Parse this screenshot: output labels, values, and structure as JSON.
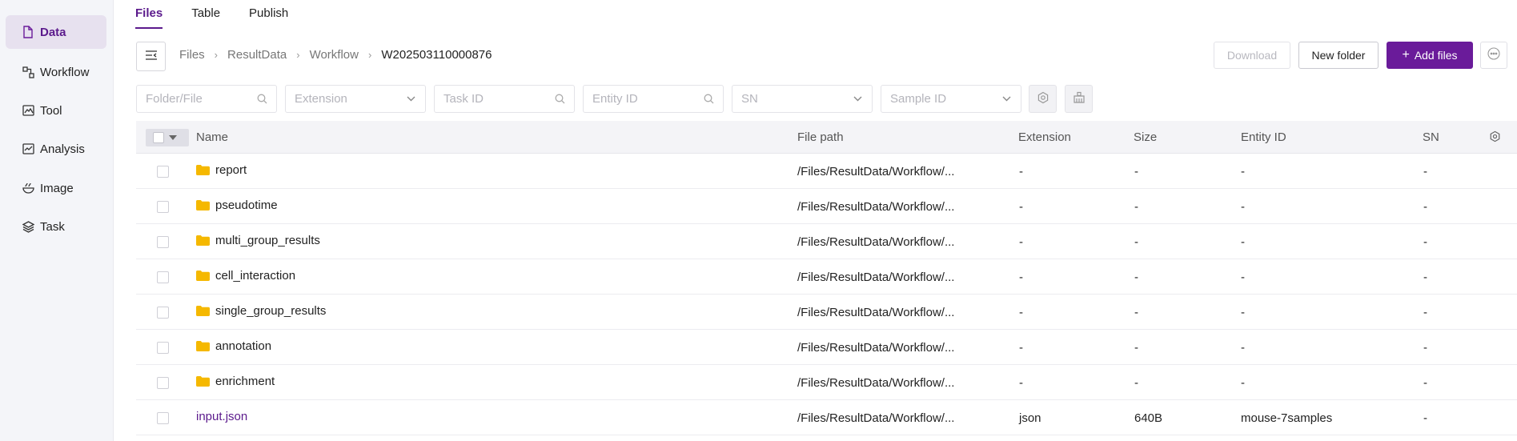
{
  "sidebar": {
    "items": [
      {
        "label": "Data",
        "icon": "file-icon",
        "active": true
      },
      {
        "label": "Workflow",
        "icon": "workflow-icon",
        "active": false
      },
      {
        "label": "Tool",
        "icon": "tool-icon",
        "active": false
      },
      {
        "label": "Analysis",
        "icon": "analysis-icon",
        "active": false
      },
      {
        "label": "Image",
        "icon": "image-icon",
        "active": false
      },
      {
        "label": "Task",
        "icon": "layers-icon",
        "active": false
      }
    ]
  },
  "tabs": [
    {
      "label": "Files",
      "active": true
    },
    {
      "label": "Table",
      "active": false
    },
    {
      "label": "Publish",
      "active": false
    }
  ],
  "breadcrumb": [
    "Files",
    "ResultData",
    "Workflow",
    "W202503110000876"
  ],
  "toolbar": {
    "download_label": "Download",
    "new_folder_label": "New folder",
    "add_files_label": "Add files"
  },
  "filters": {
    "folder_file_placeholder": "Folder/File",
    "extension_placeholder": "Extension",
    "task_id_placeholder": "Task ID",
    "entity_id_placeholder": "Entity ID",
    "sn_placeholder": "SN",
    "sample_id_placeholder": "Sample ID"
  },
  "table": {
    "columns": [
      "Name",
      "File path",
      "Extension",
      "Size",
      "Entity ID",
      "SN"
    ],
    "rows": [
      {
        "type": "folder",
        "name": "report",
        "path": "/Files/ResultData/Workflow/...",
        "extension": "-",
        "size": "-",
        "entity_id": "-",
        "sn": "-"
      },
      {
        "type": "folder",
        "name": "pseudotime",
        "path": "/Files/ResultData/Workflow/...",
        "extension": "-",
        "size": "-",
        "entity_id": "-",
        "sn": "-"
      },
      {
        "type": "folder",
        "name": "multi_group_results",
        "path": "/Files/ResultData/Workflow/...",
        "extension": "-",
        "size": "-",
        "entity_id": "-",
        "sn": "-"
      },
      {
        "type": "folder",
        "name": "cell_interaction",
        "path": "/Files/ResultData/Workflow/...",
        "extension": "-",
        "size": "-",
        "entity_id": "-",
        "sn": "-"
      },
      {
        "type": "folder",
        "name": "single_group_results",
        "path": "/Files/ResultData/Workflow/...",
        "extension": "-",
        "size": "-",
        "entity_id": "-",
        "sn": "-"
      },
      {
        "type": "folder",
        "name": "annotation",
        "path": "/Files/ResultData/Workflow/...",
        "extension": "-",
        "size": "-",
        "entity_id": "-",
        "sn": "-"
      },
      {
        "type": "folder",
        "name": "enrichment",
        "path": "/Files/ResultData/Workflow/...",
        "extension": "-",
        "size": "-",
        "entity_id": "-",
        "sn": "-"
      },
      {
        "type": "file",
        "name": "input.json",
        "path": "/Files/ResultData/Workflow/...",
        "extension": "json",
        "size": "640B",
        "entity_id": "mouse-7samples",
        "sn": "-"
      }
    ]
  },
  "colors": {
    "accent": "#6a1b9a",
    "folder": "#f5b800",
    "sidebar_bg": "#f4f5f9"
  }
}
